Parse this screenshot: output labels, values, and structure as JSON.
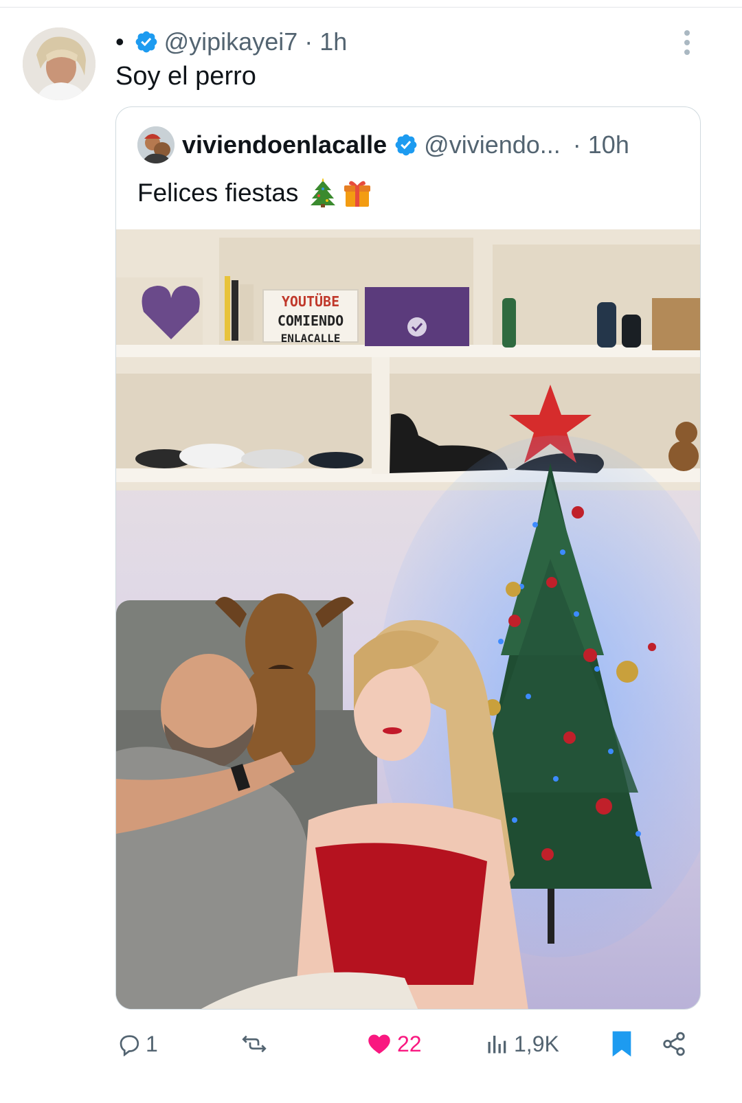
{
  "post": {
    "bullet": "•",
    "handle": "@yipikayei7",
    "time_sep": "· 1h",
    "text": "Soy el perro"
  },
  "quoted": {
    "display_name": "viviendoenlacalle",
    "handle": "@viviendo...",
    "time": "· 10h",
    "text": "Felices fiestas",
    "emojis": [
      "christmas-tree",
      "gift"
    ],
    "photo_sign": {
      "line1": "YOUTÜBE",
      "line2": "COMIENDO",
      "line3": "ENLACALLE"
    }
  },
  "actions": {
    "replies": "1",
    "retweets": "",
    "likes": "22",
    "views": "1,9K"
  },
  "colors": {
    "verified": "#1d9bf0",
    "like": "#f91880",
    "bookmark": "#1d9bf0",
    "muted_text": "#536471"
  }
}
